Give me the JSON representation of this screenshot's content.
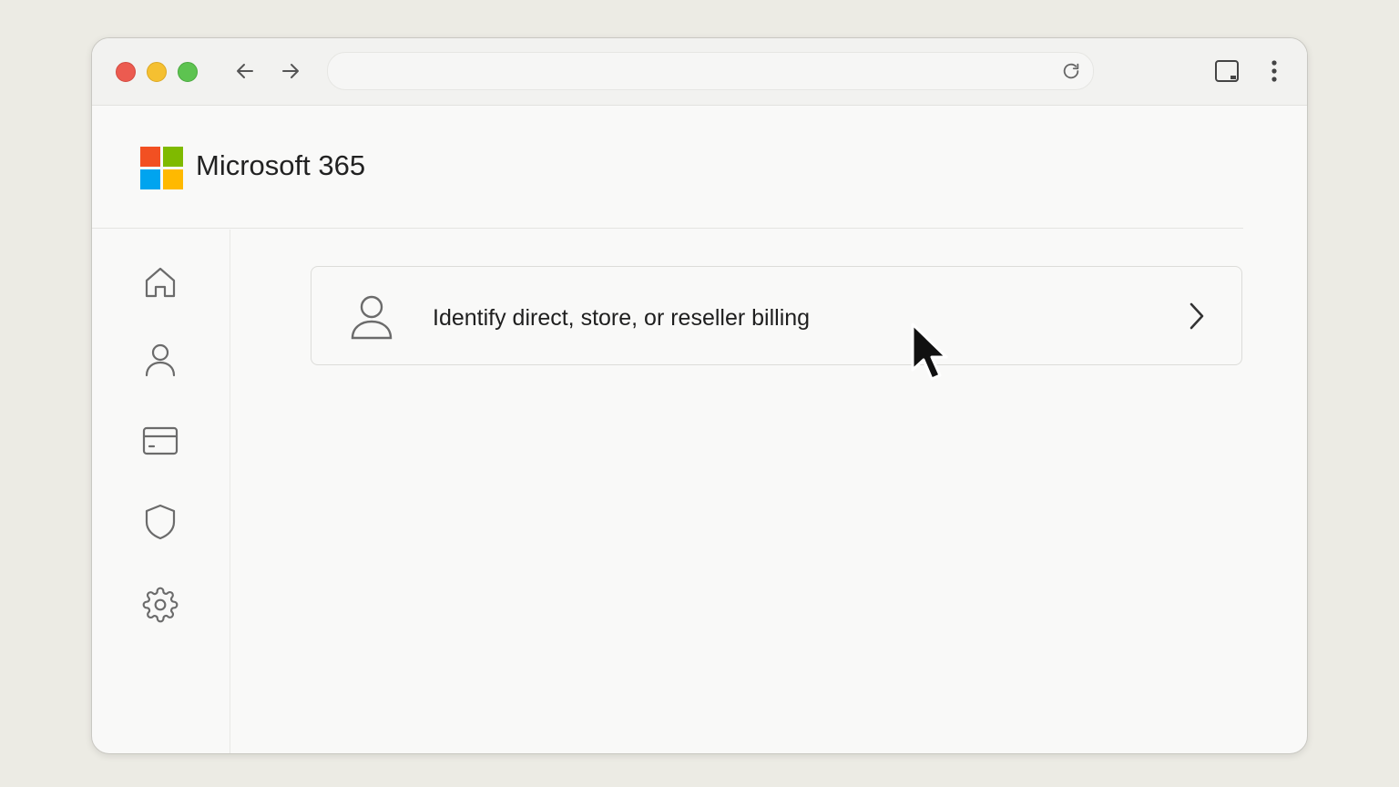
{
  "browser": {
    "url_value": "",
    "back_label": "Back",
    "forward_label": "Forward",
    "reload_label": "Reload"
  },
  "header": {
    "app_title": "Microsoft 365",
    "logo_colors": [
      "#f25022",
      "#7fba00",
      "#00a4ef",
      "#ffb900"
    ]
  },
  "sidebar": {
    "items": [
      {
        "icon": "home-icon"
      },
      {
        "icon": "user-icon"
      },
      {
        "icon": "credit-card-icon"
      },
      {
        "icon": "shield-icon"
      },
      {
        "icon": "gear-icon"
      }
    ]
  },
  "main": {
    "card": {
      "icon": "person-icon",
      "label": "Identify direct, store, or reseller billing",
      "action_icon": "chevron-right-icon"
    }
  },
  "colors": {
    "page_bg": "#ecebe4",
    "window_bg": "#f9f9f8",
    "traffic_red": "#ec5b50",
    "traffic_yellow": "#f5c031",
    "traffic_green": "#5dc350"
  }
}
